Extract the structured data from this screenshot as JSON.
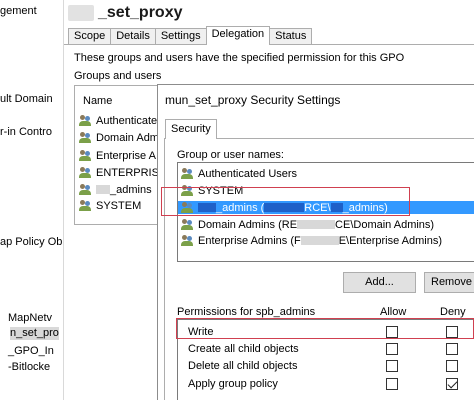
{
  "left_tree": {
    "items": [
      "gement",
      "ult Domain",
      "r-in Contro",
      "ap Policy Ob",
      "MapNetv",
      "n_set_pro",
      "_GPO_In",
      "-Bitlocke"
    ]
  },
  "gpo": {
    "title": "_set_proxy",
    "tabs": [
      "Scope",
      "Details",
      "Settings",
      "Delegation",
      "Status"
    ],
    "active_tab": "Delegation",
    "description": "These groups and users have the specified permission for this GPO",
    "groups_label": "Groups and users",
    "list_header": "Name",
    "entries": [
      "Authenticate",
      "Domain Admin",
      "Enterprise A",
      "ENTERPRIS",
      "_admins",
      "SYSTEM"
    ]
  },
  "dialog": {
    "title": "mun_set_proxy Security Settings",
    "tab": "Security",
    "group_label": "Group or user names:",
    "groups": [
      {
        "prefix": "Authenticated Users",
        "mid": "",
        "suffix": ""
      },
      {
        "prefix": "SYSTEM",
        "mid": "",
        "suffix": ""
      },
      {
        "prefix": "_admins (",
        "mid": "RCE\\",
        "suffix": "_admins)"
      },
      {
        "prefix": "Domain Admins (RE",
        "mid": "CE\\Domain Admins)",
        "suffix": ""
      },
      {
        "prefix": "Enterprise Admins (F",
        "mid": "E\\Enterprise Admins)",
        "suffix": ""
      }
    ],
    "add_button": "Add...",
    "remove_button": "Remove",
    "permissions_label": "Permissions for spb_admins",
    "allow_label": "Allow",
    "deny_label": "Deny",
    "permissions": [
      {
        "name": "Write",
        "allow": false,
        "deny": false
      },
      {
        "name": "Create all child objects",
        "allow": false,
        "deny": false
      },
      {
        "name": "Delete all child objects",
        "allow": false,
        "deny": false
      },
      {
        "name": "Apply group policy",
        "allow": false,
        "deny": true
      }
    ]
  },
  "colors": {
    "selection": "#3399ff",
    "highlight_border": "#d04050",
    "redaction": "#1e60c8"
  }
}
